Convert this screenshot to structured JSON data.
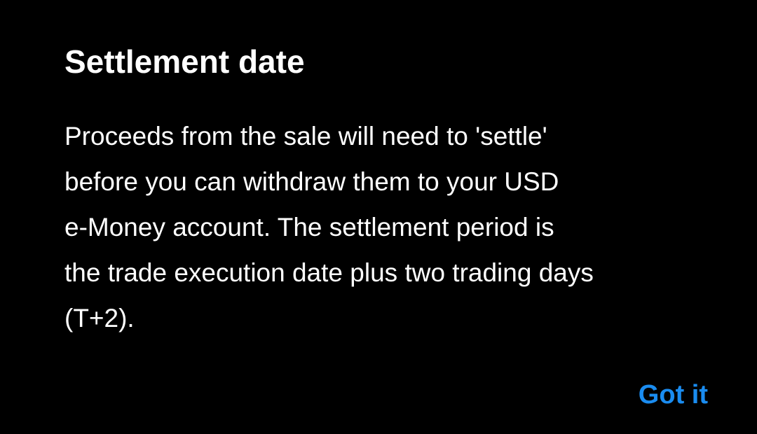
{
  "dialog": {
    "title": "Settlement date",
    "body_lines": [
      "Proceeds from the sale will need to 'settle'",
      "before you can withdraw them to your USD",
      "e-Money account. The settlement period is",
      "the trade execution date plus two trading days",
      "(T+2)."
    ],
    "confirm_label": "Got it"
  },
  "colors": {
    "background": "#000000",
    "text": "#ffffff",
    "accent": "#1a8cf0"
  }
}
